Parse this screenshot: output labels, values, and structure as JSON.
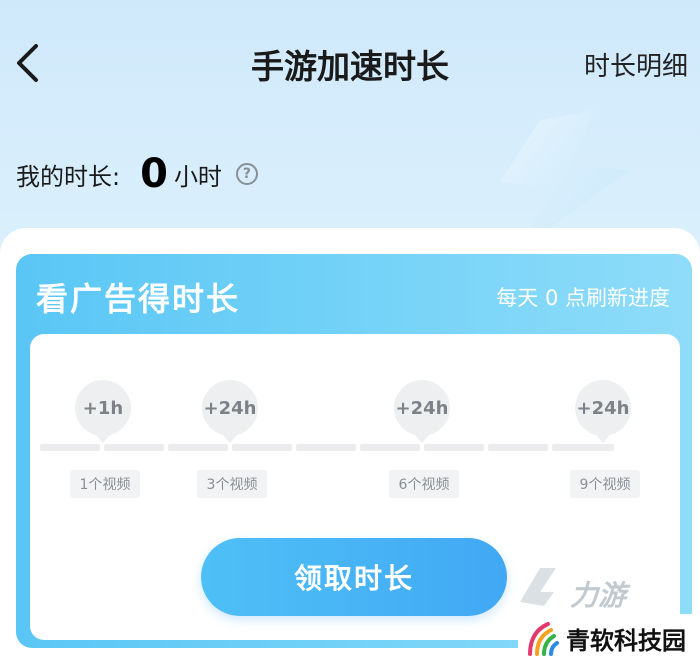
{
  "header": {
    "title": "手游加速时长",
    "detail_link": "时长明细",
    "back_icon": "chevron-left-icon"
  },
  "summary": {
    "label": "我的时长:",
    "value": "0",
    "unit": "小时",
    "help_icon": "?"
  },
  "ad_card": {
    "title": "看广告得时长",
    "refresh_note": "每天 0 点刷新进度",
    "milestones": [
      {
        "reward": "+1h",
        "videos": "1个视频"
      },
      {
        "reward": "+24h",
        "videos": "3个视频"
      },
      {
        "reward": "+24h",
        "videos": "6个视频"
      },
      {
        "reward": "+24h",
        "videos": "9个视频"
      }
    ],
    "progress_videos": 0,
    "total_videos": 9,
    "claim_button": "领取时长"
  },
  "watermark": {
    "logo_text": "力游",
    "brand": "青软科技园"
  },
  "colors": {
    "accent": "#41a8f4",
    "card_bg": "#5ac6f5",
    "bubble_bg": "#eeeff1",
    "track": "#ececee"
  }
}
